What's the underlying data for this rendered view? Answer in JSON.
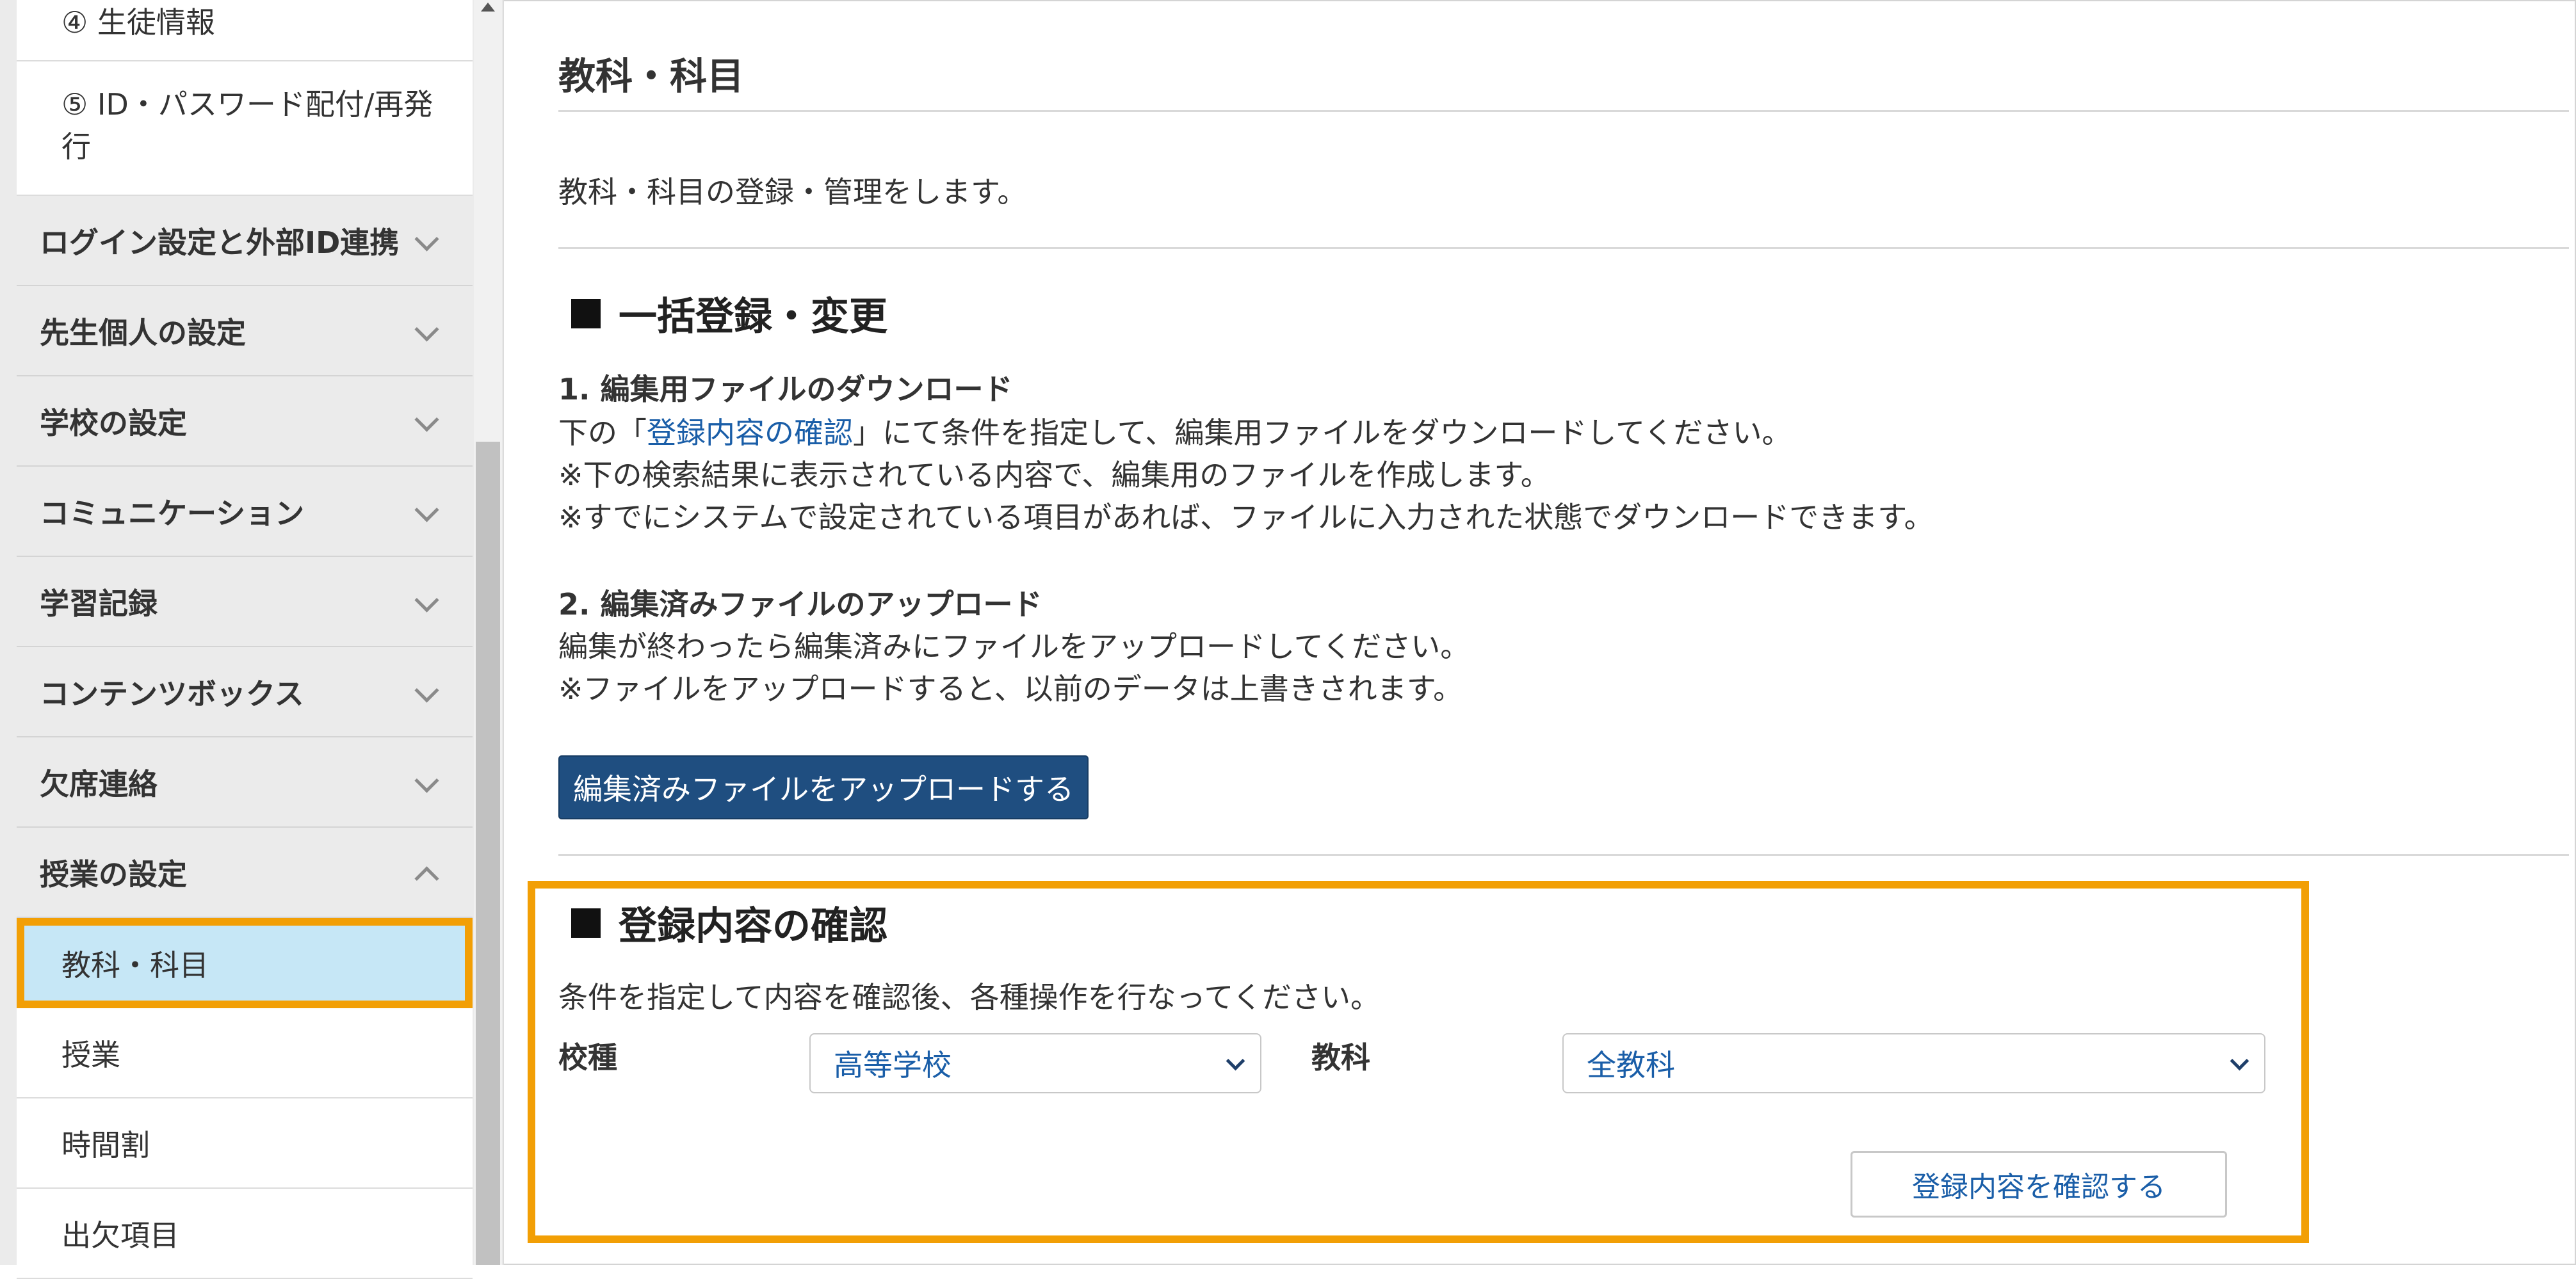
{
  "sidebar": {
    "items_top": [
      {
        "label": "④ 生徒情報"
      },
      {
        "label": "⑤ ID・パスワード配付/再発行"
      }
    ],
    "categories": [
      {
        "label": "ログイン設定と外部ID連携",
        "expanded": false
      },
      {
        "label": "先生個人の設定",
        "expanded": false
      },
      {
        "label": "学校の設定",
        "expanded": false
      },
      {
        "label": "コミュニケーション",
        "expanded": false
      },
      {
        "label": "学習記録",
        "expanded": false
      },
      {
        "label": "コンテンツボックス",
        "expanded": false
      },
      {
        "label": "欠席連絡",
        "expanded": false
      },
      {
        "label": "授業の設定",
        "expanded": true
      }
    ],
    "sub_items": [
      {
        "label": "教科・科目",
        "active": true
      },
      {
        "label": "授業",
        "active": false
      },
      {
        "label": "時間割",
        "active": false
      },
      {
        "label": "出欠項目",
        "active": false
      }
    ]
  },
  "main": {
    "title": "教科・科目",
    "description": "教科・科目の登録・管理をします。",
    "bulk": {
      "title": "一括登録・変更",
      "step1": {
        "title": "1. 編集用ファイルのダウンロード",
        "line1_pre": "下の「",
        "line1_link": "登録内容の確認",
        "line1_post": "」にて条件を指定して、編集用ファイルをダウンロードしてください。",
        "line2": "※下の検索結果に表示されている内容で、編集用のファイルを作成します。",
        "line3": "※すでにシステムで設定されている項目があれば、ファイルに入力された状態でダウンロードできます。"
      },
      "step2": {
        "title": "2. 編集済みファイルのアップロード",
        "line1": "編集が終わったら編集済みにファイルをアップロードしてください。",
        "line2": "※ファイルをアップロードすると、以前のデータは上書きされます。"
      },
      "upload_button": "編集済みファイルをアップロードする"
    },
    "confirm": {
      "title": "登録内容の確認",
      "description": "条件を指定して内容を確認後、各種操作を行なってください。",
      "school_type_label": "校種",
      "school_type_value": "高等学校",
      "subject_label": "教科",
      "subject_value": "全教科",
      "button": "登録内容を確認する"
    }
  },
  "colors": {
    "accent_highlight": "#f29f05",
    "active_item_bg": "#c6e7f6",
    "primary_button": "#1f4e80",
    "link": "#1a5ea8"
  }
}
